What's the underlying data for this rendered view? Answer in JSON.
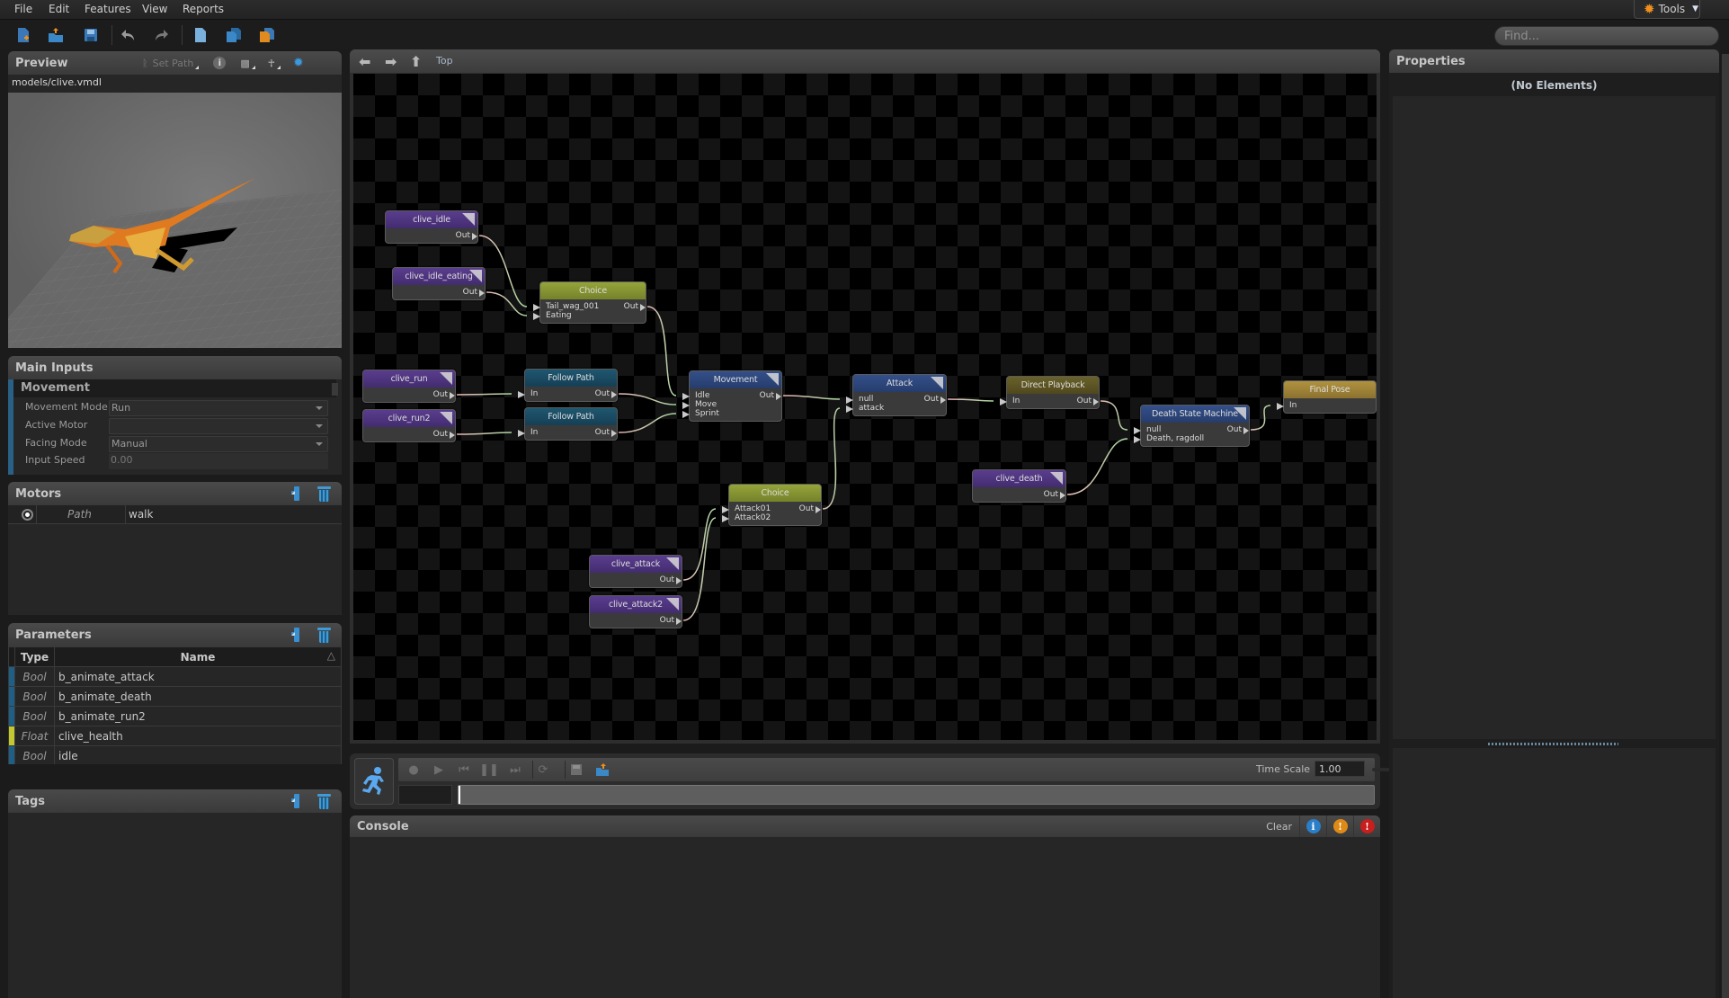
{
  "menu": [
    "File",
    "Edit",
    "Features",
    "View",
    "Reports"
  ],
  "tools_label": "Tools",
  "find_placeholder": "Find...",
  "toolbar_icons": [
    "new-file-icon",
    "open-folder-icon",
    "save-icon",
    "undo-icon",
    "redo-icon",
    "document-icon",
    "copy-documents-icon",
    "orange-documents-icon"
  ],
  "preview": {
    "title": "Preview",
    "set_path": "Set Path",
    "model_path": "models/clive.vmdl"
  },
  "main_inputs": {
    "title": "Main Inputs",
    "group": "Movement",
    "rows": [
      {
        "label": "Movement Mode",
        "value": "Run",
        "dropdown": true
      },
      {
        "label": "Active Motor",
        "value": "",
        "dropdown": true
      },
      {
        "label": "Facing Mode",
        "value": "Manual",
        "dropdown": true
      },
      {
        "label": "Input Speed",
        "value": "0.00",
        "dropdown": false
      }
    ]
  },
  "motors": {
    "title": "Motors",
    "rows": [
      {
        "type": "Path",
        "name": "walk"
      }
    ]
  },
  "parameters": {
    "title": "Parameters",
    "columns": [
      "Type",
      "Name"
    ],
    "rows": [
      {
        "type": "Bool",
        "name": "b_animate_attack",
        "color": "#1f5f86"
      },
      {
        "type": "Bool",
        "name": "b_animate_death",
        "color": "#1f5f86"
      },
      {
        "type": "Bool",
        "name": "b_animate_run2",
        "color": "#1f5f86"
      },
      {
        "type": "Float",
        "name": "clive_health",
        "color": "#c4c830"
      },
      {
        "type": "Bool",
        "name": "idle",
        "color": "#1f5f86"
      }
    ]
  },
  "tags": {
    "title": "Tags"
  },
  "graph": {
    "breadcrumb": "Top",
    "nodes": [
      {
        "id": "clive_idle",
        "title": "clive_idle",
        "style": "purple",
        "corner": true,
        "inputs": [],
        "outputs": [
          "Out"
        ]
      },
      {
        "id": "clive_idle_eating",
        "title": "clive_idle_eating",
        "style": "purple",
        "corner": true,
        "inputs": [],
        "outputs": [
          "Out"
        ]
      },
      {
        "id": "choice1",
        "title": "Choice",
        "style": "olive",
        "corner": false,
        "inputs": [
          "Tail_wag_001",
          "Eating"
        ],
        "outputs": [
          "Out"
        ]
      },
      {
        "id": "clive_run",
        "title": "clive_run",
        "style": "purple",
        "corner": true,
        "inputs": [],
        "outputs": [
          "Out"
        ]
      },
      {
        "id": "clive_run2",
        "title": "clive_run2",
        "style": "purple",
        "corner": true,
        "inputs": [],
        "outputs": [
          "Out"
        ]
      },
      {
        "id": "follow1",
        "title": "Follow Path",
        "style": "teal",
        "corner": false,
        "inputs": [
          "In"
        ],
        "outputs": [
          "Out"
        ]
      },
      {
        "id": "follow2",
        "title": "Follow Path",
        "style": "teal",
        "corner": false,
        "inputs": [
          "In"
        ],
        "outputs": [
          "Out"
        ]
      },
      {
        "id": "movement",
        "title": "Movement",
        "style": "navy",
        "corner": true,
        "inputs": [
          "Idle",
          "Move",
          "Sprint"
        ],
        "outputs": [
          "Out"
        ]
      },
      {
        "id": "attack",
        "title": "Attack",
        "style": "navy",
        "corner": true,
        "inputs": [
          "null",
          "attack"
        ],
        "outputs": [
          "Out"
        ]
      },
      {
        "id": "direct",
        "title": "Direct Playback",
        "style": "brownolive",
        "corner": false,
        "inputs": [
          "In"
        ],
        "outputs": [
          "Out"
        ]
      },
      {
        "id": "deathsm",
        "title": "Death State Machine",
        "style": "navy",
        "corner": true,
        "inputs": [
          "null",
          "Death, ragdoll"
        ],
        "outputs": [
          "Out"
        ]
      },
      {
        "id": "finalpose",
        "title": "Final Pose",
        "style": "gold",
        "corner": false,
        "inputs": [
          "In"
        ],
        "outputs": []
      },
      {
        "id": "clive_death",
        "title": "clive_death",
        "style": "purple",
        "corner": true,
        "inputs": [],
        "outputs": [
          "Out"
        ]
      },
      {
        "id": "choice2",
        "title": "Choice",
        "style": "olive",
        "corner": false,
        "inputs": [
          "Attack01",
          "Attack02"
        ],
        "outputs": [
          "Out"
        ]
      },
      {
        "id": "clive_attack",
        "title": "clive_attack",
        "style": "purple",
        "corner": true,
        "inputs": [],
        "outputs": [
          "Out"
        ]
      },
      {
        "id": "clive_attack2",
        "title": "clive_attack2",
        "style": "purple",
        "corner": true,
        "inputs": [],
        "outputs": [
          "Out"
        ]
      }
    ],
    "connections": [
      [
        "clive_idle",
        0,
        "choice1",
        0
      ],
      [
        "clive_idle_eating",
        0,
        "choice1",
        1
      ],
      [
        "choice1",
        0,
        "movement",
        0
      ],
      [
        "clive_run",
        0,
        "follow1",
        0
      ],
      [
        "clive_run2",
        0,
        "follow2",
        0
      ],
      [
        "follow1",
        0,
        "movement",
        1
      ],
      [
        "follow2",
        0,
        "movement",
        2
      ],
      [
        "movement",
        0,
        "attack",
        0
      ],
      [
        "choice2",
        0,
        "attack",
        1
      ],
      [
        "clive_attack",
        0,
        "choice2",
        0
      ],
      [
        "clive_attack2",
        0,
        "choice2",
        1
      ],
      [
        "attack",
        0,
        "direct",
        0
      ],
      [
        "direct",
        0,
        "deathsm",
        0
      ],
      [
        "clive_death",
        0,
        "deathsm",
        1
      ],
      [
        "deathsm",
        0,
        "finalpose",
        0
      ]
    ]
  },
  "playback": {
    "time_scale_label": "Time Scale",
    "time_scale_value": "1.00",
    "time_scale_slider": 0.5,
    "frame_value": ""
  },
  "console": {
    "title": "Console",
    "clear_label": "Clear",
    "colors": {
      "info": "#2a7fc8",
      "warning": "#e08a16",
      "error": "#c81e1e"
    }
  },
  "properties": {
    "title": "Properties",
    "empty_text": "(No Elements)"
  }
}
